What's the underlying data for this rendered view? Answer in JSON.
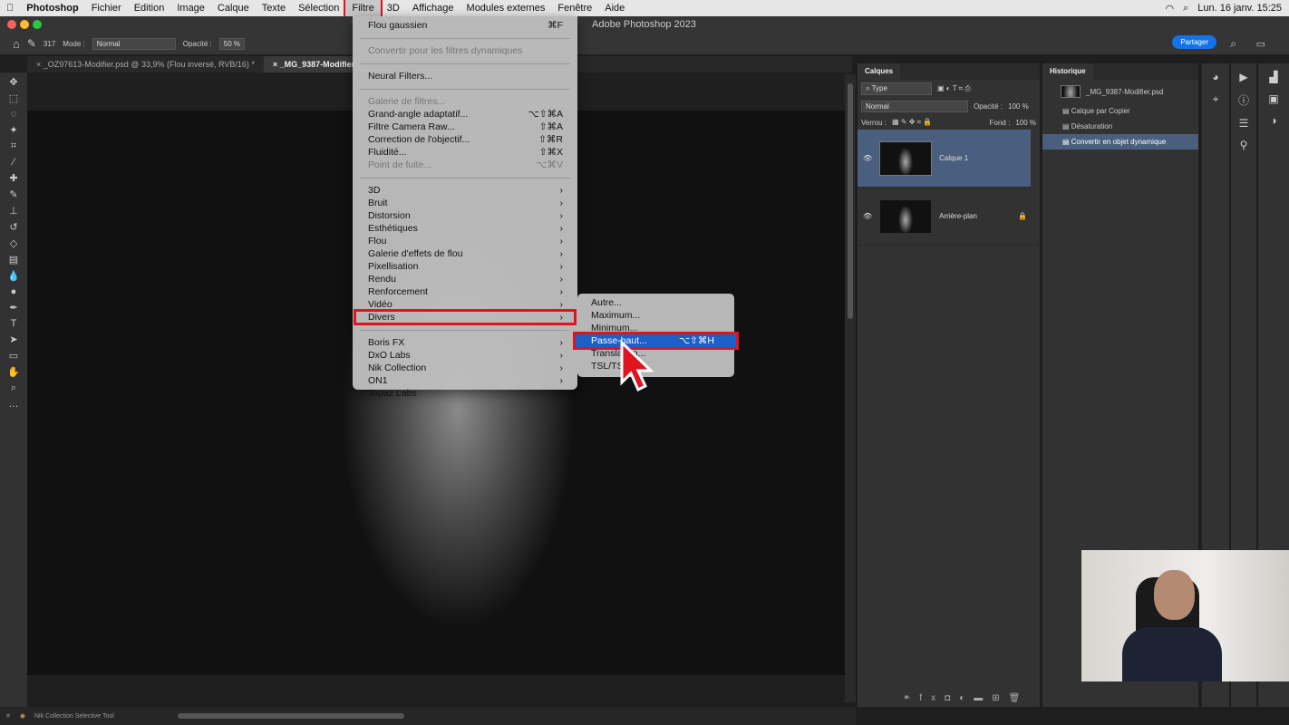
{
  "menubar": {
    "app": "Photoshop",
    "items": [
      "Fichier",
      "Edition",
      "Image",
      "Calque",
      "Texte",
      "Sélection",
      "Filtre",
      "3D",
      "Affichage",
      "Modules externes",
      "Fenêtre",
      "Aide"
    ],
    "clock": "Lun. 16 janv.  15:25"
  },
  "window": {
    "title": "Adobe Photoshop 2023"
  },
  "options": {
    "brush_size": "317",
    "mode_label": "Mode :",
    "mode": "Normal",
    "opacity_label": "Opacité :",
    "opacity": "50 %",
    "share": "Partager"
  },
  "tabs": [
    {
      "label": "× _OZ97613-Modifier.psd @ 33,9% (Flou inversé, RVB/16) *"
    },
    {
      "label": "× _MG_9387-Modifier"
    }
  ],
  "filter_menu": [
    {
      "label": "Flou gaussien",
      "shortcut": "⌘F"
    },
    {
      "sep": true
    },
    {
      "label": "Convertir pour les filtres dynamiques",
      "disabled": true
    },
    {
      "sep": true
    },
    {
      "label": "Neural Filters..."
    },
    {
      "sep": true
    },
    {
      "label": "Galerie de filtres...",
      "disabled": true
    },
    {
      "label": "Grand-angle adaptatif...",
      "shortcut": "⌥⇧⌘A"
    },
    {
      "label": "Filtre Camera Raw...",
      "shortcut": "⇧⌘A"
    },
    {
      "label": "Correction de l'objectif...",
      "shortcut": "⇧⌘R"
    },
    {
      "label": "Fluidité...",
      "shortcut": "⇧⌘X"
    },
    {
      "label": "Point de fuite...",
      "shortcut": "⌥⌘V",
      "disabled": true
    },
    {
      "sep": true
    },
    {
      "label": "3D",
      "sub": true
    },
    {
      "label": "Bruit",
      "sub": true
    },
    {
      "label": "Distorsion",
      "sub": true
    },
    {
      "label": "Esthétiques",
      "sub": true
    },
    {
      "label": "Flou",
      "sub": true
    },
    {
      "label": "Galerie d'effets de flou",
      "sub": true
    },
    {
      "label": "Pixellisation",
      "sub": true
    },
    {
      "label": "Rendu",
      "sub": true
    },
    {
      "label": "Renforcement",
      "sub": true
    },
    {
      "label": "Vidéo",
      "sub": true
    },
    {
      "label": "Divers",
      "sub": true,
      "boxed": true
    },
    {
      "sep": true
    },
    {
      "label": "Boris FX",
      "sub": true
    },
    {
      "label": "DxO Labs",
      "sub": true
    },
    {
      "label": "Nik Collection",
      "sub": true
    },
    {
      "label": "ON1",
      "sub": true
    },
    {
      "label": "Topaz Labs",
      "sub": true
    }
  ],
  "divers_submenu": [
    {
      "label": "Autre..."
    },
    {
      "label": "Maximum..."
    },
    {
      "label": "Minimum..."
    },
    {
      "label": "Passe-haut...",
      "shortcut": "⌥⇧⌘H",
      "highlighted": true
    },
    {
      "label": "Translation..."
    },
    {
      "label": "TSL/TSV..."
    }
  ],
  "layers_panel": {
    "title": "Calques",
    "filter": "Type",
    "blend": "Normal",
    "opacity_label": "Opacité :",
    "opacity": "100 %",
    "lock_label": "Verrou :",
    "fill_label": "Fond :",
    "fill": "100 %",
    "layers": [
      {
        "name": "Calque 1",
        "selected": true
      },
      {
        "name": "Arrière-plan",
        "locked": true
      }
    ]
  },
  "history_panel": {
    "title": "Historique",
    "snapshot": "_MG_9387-Modifier.psd",
    "steps": [
      {
        "label": "Calque par Copier"
      },
      {
        "label": "Désaturation"
      },
      {
        "label": "Convertir en objet dynamique",
        "active": true
      }
    ]
  },
  "statusbar": {
    "plugin": "Nik Collection Selective Tool"
  },
  "colors": {
    "accent": "#1473e6",
    "highlight": "#1c5fc9",
    "annotation": "#e0141e"
  }
}
